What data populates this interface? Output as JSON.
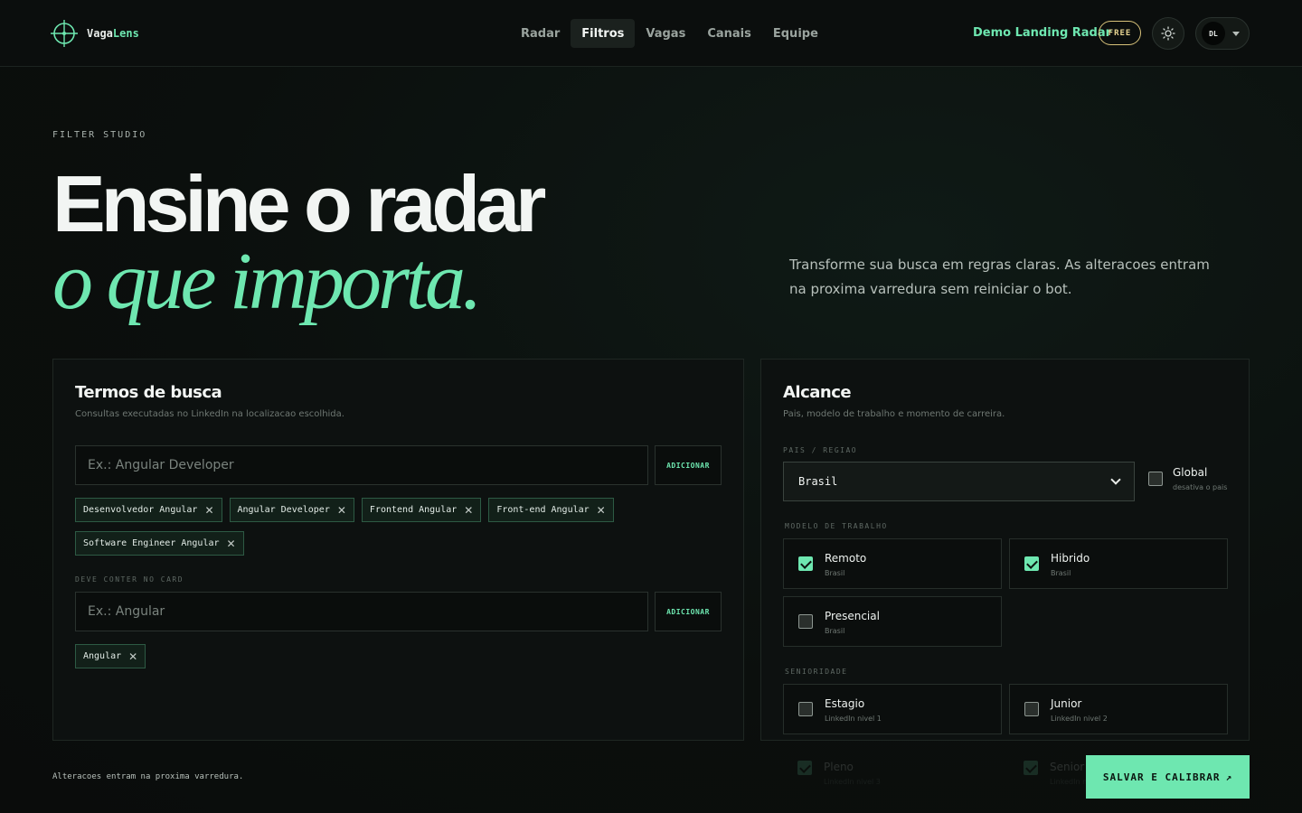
{
  "brand": {
    "name_prefix": "Vaga",
    "name_accent": "Lens"
  },
  "nav": {
    "items": [
      {
        "label": "Radar",
        "active": false
      },
      {
        "label": "Filtros",
        "active": true
      },
      {
        "label": "Vagas",
        "active": false
      },
      {
        "label": "Canais",
        "active": false
      },
      {
        "label": "Equipe",
        "active": false
      }
    ]
  },
  "header": {
    "demo_link": "Demo Landing Radar",
    "plan_badge": "FREE",
    "theme_icon": "sun-icon",
    "user_initials": "DL"
  },
  "hero": {
    "eyebrow": "FILTER STUDIO",
    "title_line1": "Ensine o radar",
    "title_line2": "o que importa.",
    "description": "Transforme sua busca em regras claras. As alteracoes entram na proxima varredura sem reiniciar o bot."
  },
  "search_terms": {
    "title": "Termos de busca",
    "subtitle": "Consultas executadas no LinkedIn na localizacao escolhida.",
    "input_placeholder": "Ex.: Angular Developer",
    "add_label": "ADICIONAR",
    "chips": [
      "Desenvolvedor Angular",
      "Angular Developer",
      "Frontend Angular",
      "Front-end Angular",
      "Software Engineer Angular"
    ],
    "must_contain": {
      "label": "DEVE CONTER NO CARD",
      "input_placeholder": "Ex.: Angular",
      "add_label": "ADICIONAR",
      "chips": [
        "Angular"
      ]
    }
  },
  "reach": {
    "title": "Alcance",
    "subtitle": "Pais, modelo de trabalho e momento de carreira.",
    "country_label": "PAIS / REGIAO",
    "country_value": "Brasil",
    "global": {
      "title": "Global",
      "sub": "desativa o pais",
      "checked": false
    },
    "work_model_label": "MODELO DE TRABALHO",
    "work_models": [
      {
        "title": "Remoto",
        "sub": "Brasil",
        "checked": true
      },
      {
        "title": "Hibrido",
        "sub": "Brasil",
        "checked": true
      },
      {
        "title": "Presencial",
        "sub": "Brasil",
        "checked": false
      }
    ],
    "seniority_label": "SENIORIDADE",
    "seniority": [
      {
        "title": "Estagio",
        "sub": "LinkedIn nivel 1",
        "checked": false
      },
      {
        "title": "Junior",
        "sub": "LinkedIn nivel 2",
        "checked": false
      },
      {
        "title": "Pleno",
        "sub": "LinkedIn nivel 3",
        "checked": true
      },
      {
        "title": "Senior",
        "sub": "LinkedIn nivel 4",
        "checked": true
      }
    ]
  },
  "footer": {
    "note": "Alteracoes entram na proxima varredura.",
    "save_label": "SALVAR E CALIBRAR",
    "save_icon": "arrow-up-right-icon"
  },
  "colors": {
    "accent": "#6ee7b0",
    "background": "#0b0e0d",
    "badge": "#d8c27a"
  }
}
